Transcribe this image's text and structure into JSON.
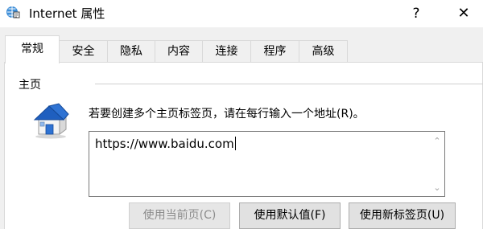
{
  "window": {
    "title": "Internet 属性",
    "help_label": "?",
    "close_label": "✕"
  },
  "tabs": [
    {
      "label": "常规",
      "active": true
    },
    {
      "label": "安全",
      "active": false
    },
    {
      "label": "隐私",
      "active": false
    },
    {
      "label": "内容",
      "active": false
    },
    {
      "label": "连接",
      "active": false
    },
    {
      "label": "程序",
      "active": false
    },
    {
      "label": "高级",
      "active": false
    }
  ],
  "home_page": {
    "group_label": "主页",
    "instruction": "若要创建多个主页标签页，请在每行输入一个地址(R)。",
    "url_value": "https://www.baidu.com",
    "scroll_up": "⌃",
    "scroll_down": "⌄"
  },
  "buttons": {
    "use_current": "使用当前页(C)",
    "use_default": "使用默认值(F)",
    "use_new_tab": "使用新标签页(U)"
  },
  "icons": {
    "app": "internet-options-icon",
    "home": "home-icon"
  },
  "colors": {
    "window_bg": "#f0f0f0",
    "panel_bg": "#ffffff",
    "button_bg": "#e1e1e1",
    "house_roof": "#1f5fbf",
    "house_wall": "#f4f4f4"
  }
}
